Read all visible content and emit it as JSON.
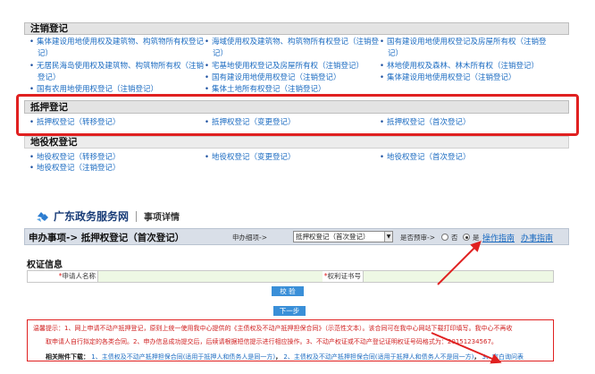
{
  "registration": {
    "heading": "注销登记",
    "items": [
      [
        "集体建设用地使用权及建筑物、构筑物所有权登记",
        "海域使用权及建筑物、构筑物所有权登记（注销登",
        "国有建设用地使用权登记及房屋所有权（注销登"
      ],
      [
        "记）",
        "记）",
        "记）"
      ],
      [
        "无居民海岛使用权及建筑物、构筑物所有权（注销",
        "宅基地使用权登记及房屋所有权（注销登记）",
        "林地使用权及森林、林木所有权（注销登记）"
      ],
      [
        "登记）",
        "国有建设用地使用权登记（注销登记）",
        "集体建设用地使用权登记（注销登记）"
      ],
      [
        "国有农用地使用权登记（注销登记）",
        "集体土地所有权登记（注销登记）",
        ""
      ]
    ]
  },
  "mortgage": {
    "heading": "抵押登记",
    "items": [
      "抵押权登记（转移登记）",
      "抵押权登记（变更登记）",
      "抵押权登记（首次登记）"
    ]
  },
  "easement": {
    "heading": "地役权登记",
    "items": [
      [
        "地役权登记（转移登记）",
        "地役权登记（变更登记）",
        "地役权登记（首次登记）"
      ],
      [
        "地役权登记（注销登记）",
        "",
        ""
      ]
    ]
  },
  "brand": {
    "name": "广东政务服务网",
    "sub": "事项详情"
  },
  "titlebar": {
    "title": "申办事项-> 抵押权登记（首次登记）",
    "matter_label": "申办细项->",
    "matter_value": "抵押权登记（首次登记）",
    "prebook_label": "是否预审->",
    "no": "否",
    "yes": "是",
    "guide": "操作指南",
    "handbook": "办事指南"
  },
  "form": {
    "title": "权证信息",
    "applicant_label": "申请人名称",
    "cert_label": "权利证书号",
    "verify": "校  验",
    "next": "下一步"
  },
  "tips": {
    "line1": "温馨提示：1、网上申请不动产抵押登记，原则上统一使用我中心提供的《主债权及不动产抵押担保合同》（示范性文本）。该合同可在我中心网站下载打印填写。我中心不再收",
    "line2": "取申请人自行拟定的各类合同。2、申办信息成功提交后，后续请根据短信提示进行相应操作。3、不动产权证或不动产登记证明权证号码格式为：20151234567。",
    "att_label": "相关附件下载：",
    "att1": "1、主债权及不动产抵押担保合同(适用于抵押人和债务人是同一方)",
    "att2": "2、主债权及不动产抵押担保合同(适用于抵押人和债务人不是同一方)",
    "att3": "3、空白询问表"
  }
}
